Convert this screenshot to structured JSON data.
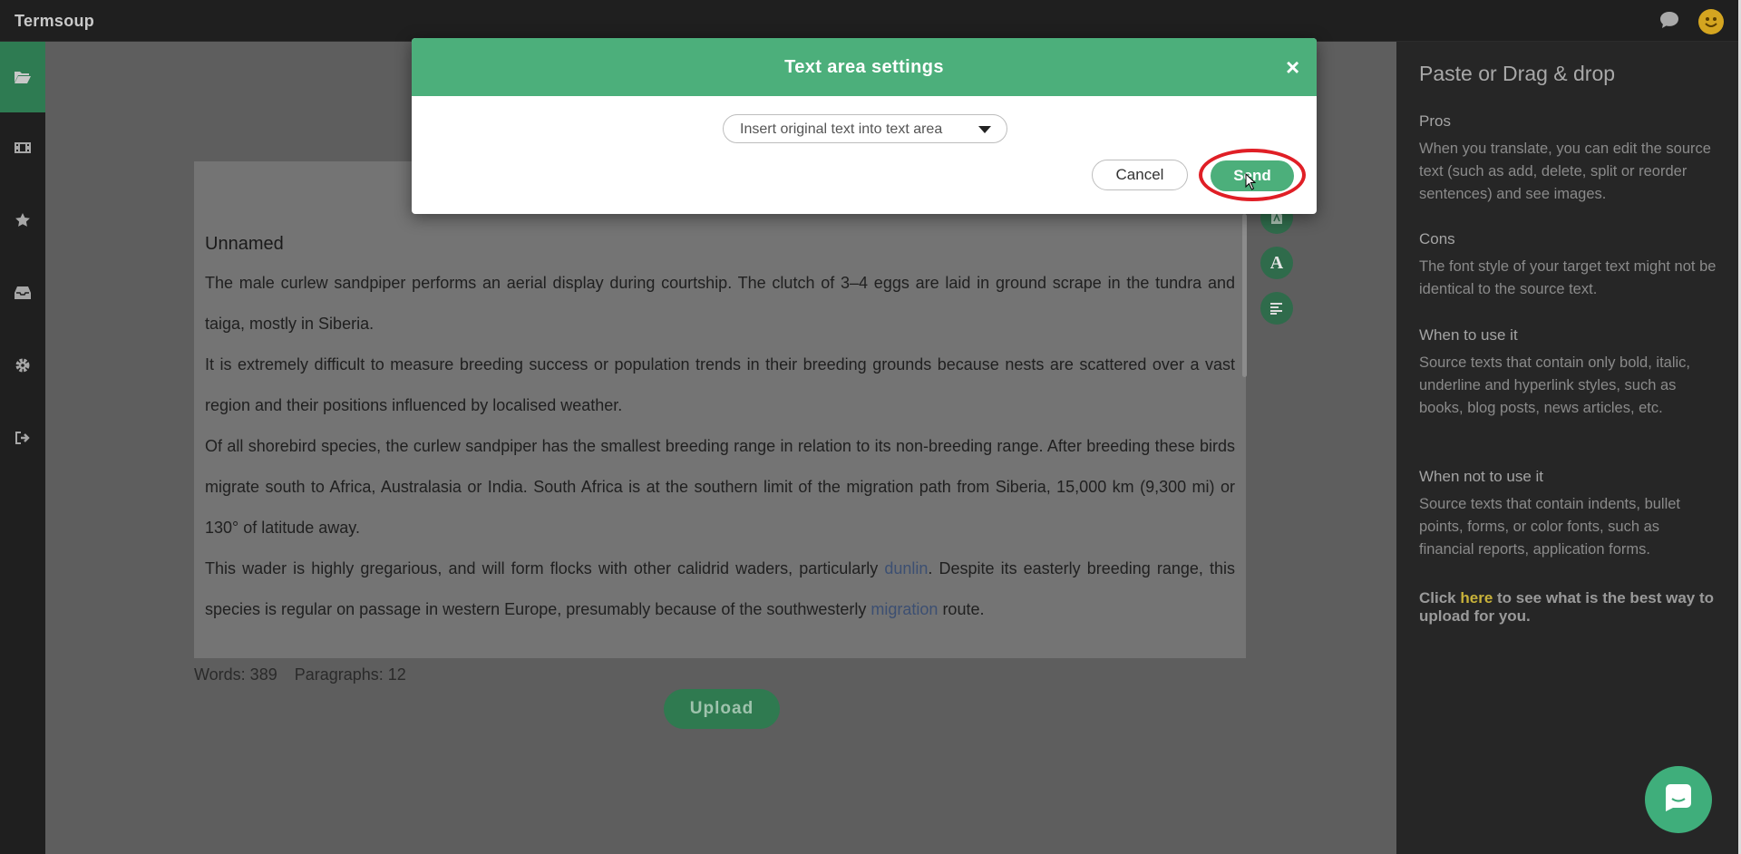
{
  "app": {
    "title": "Termsoup"
  },
  "document": {
    "title": "Unnamed",
    "paragraphs": [
      {
        "text": "The male curlew sandpiper performs an aerial display during courtship. The clutch of 3–4 eggs are laid in ground scrape in the tundra and taiga, mostly in Siberia."
      },
      {
        "text": "It is extremely difficult to measure breeding success or population trends in their breeding grounds because nests are scattered over a vast region and their positions influenced by localised weather."
      },
      {
        "text": "Of all shorebird species, the curlew sandpiper has the smallest breeding range in relation to its non-breeding range. After breeding these birds migrate south to Africa, Australasia or India. South Africa is at the southern limit of the migration path from Siberia, 15,000 km (9,300 mi) or 130° of latitude away."
      },
      {
        "before": "This wader is highly gregarious, and will form flocks with other calidrid waders, particularly ",
        "link1": "dunlin",
        "middle": ". Despite its easterly breeding range, this species is regular on passage in western Europe, presumably because of the southwesterly ",
        "link2": "migration",
        "after": " route."
      }
    ]
  },
  "stats": {
    "words": "Words: 389",
    "paragraphs": "Paragraphs: 12"
  },
  "upload_label": "Upload",
  "modal": {
    "title": "Text area settings",
    "close": "×",
    "select_value": "Insert original text into text area",
    "cancel_label": "Cancel",
    "send_label": "Send"
  },
  "right_panel": {
    "title": "Paste or Drag & drop",
    "sections": [
      {
        "heading": "Pros",
        "text": "When you translate, you can edit the source text (such as add, delete, split or reorder sentences) and see images."
      },
      {
        "heading": "Cons",
        "text": "The font style of your target text might not be identical to the source text."
      },
      {
        "heading": "When to use it",
        "text": "Source texts that contain only bold, italic, underline and hyperlink styles, such as books, blog posts, news articles, etc."
      },
      {
        "heading": "When not to use it",
        "text": "Source texts that contain indents, bullet points, forms, or color fonts, such as financial reports, application forms."
      }
    ],
    "click_prefix": "Click ",
    "click_link": "here",
    "click_suffix": " to see what is the best way to upload for you."
  },
  "colors": {
    "accent": "#4caf7b",
    "highlight": "#e01f26",
    "link_yellow": "#c8b23a"
  },
  "icons": [
    "folder-open-icon",
    "film-icon",
    "star-icon",
    "inbox-icon",
    "gear-icon",
    "sign-out-icon",
    "chat-icon",
    "smiley-icon",
    "pdf-icon",
    "font-icon",
    "align-left-icon",
    "close-icon",
    "caret-down-icon",
    "cursor-icon"
  ]
}
